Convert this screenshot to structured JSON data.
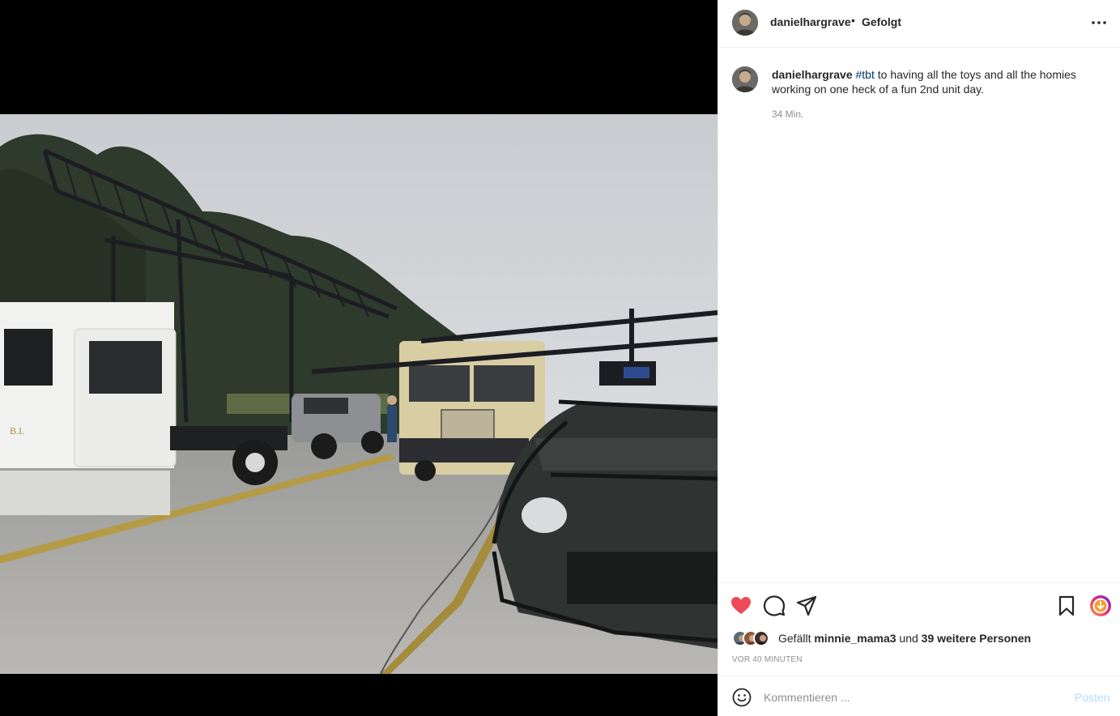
{
  "post": {
    "username": "danielhargrave",
    "dot": "•",
    "follow_status": "Gefolgt"
  },
  "caption": {
    "username": "danielhargrave",
    "hashtag": "#tbt",
    "text": " to having all the toys and all the homies working on one heck of a fun 2nd unit day.",
    "time": "34 Min."
  },
  "actions": {
    "liked": true,
    "like_color": "#ed4956",
    "likes_prefix": "Gefällt ",
    "likes_user": "minnie_mama3",
    "likes_middle": " und ",
    "likes_others": "39 weitere Personen",
    "posted_time": "VOR 40 MINUTEN"
  },
  "comment": {
    "placeholder": "Kommentieren ...",
    "post_label": "Posten"
  }
}
